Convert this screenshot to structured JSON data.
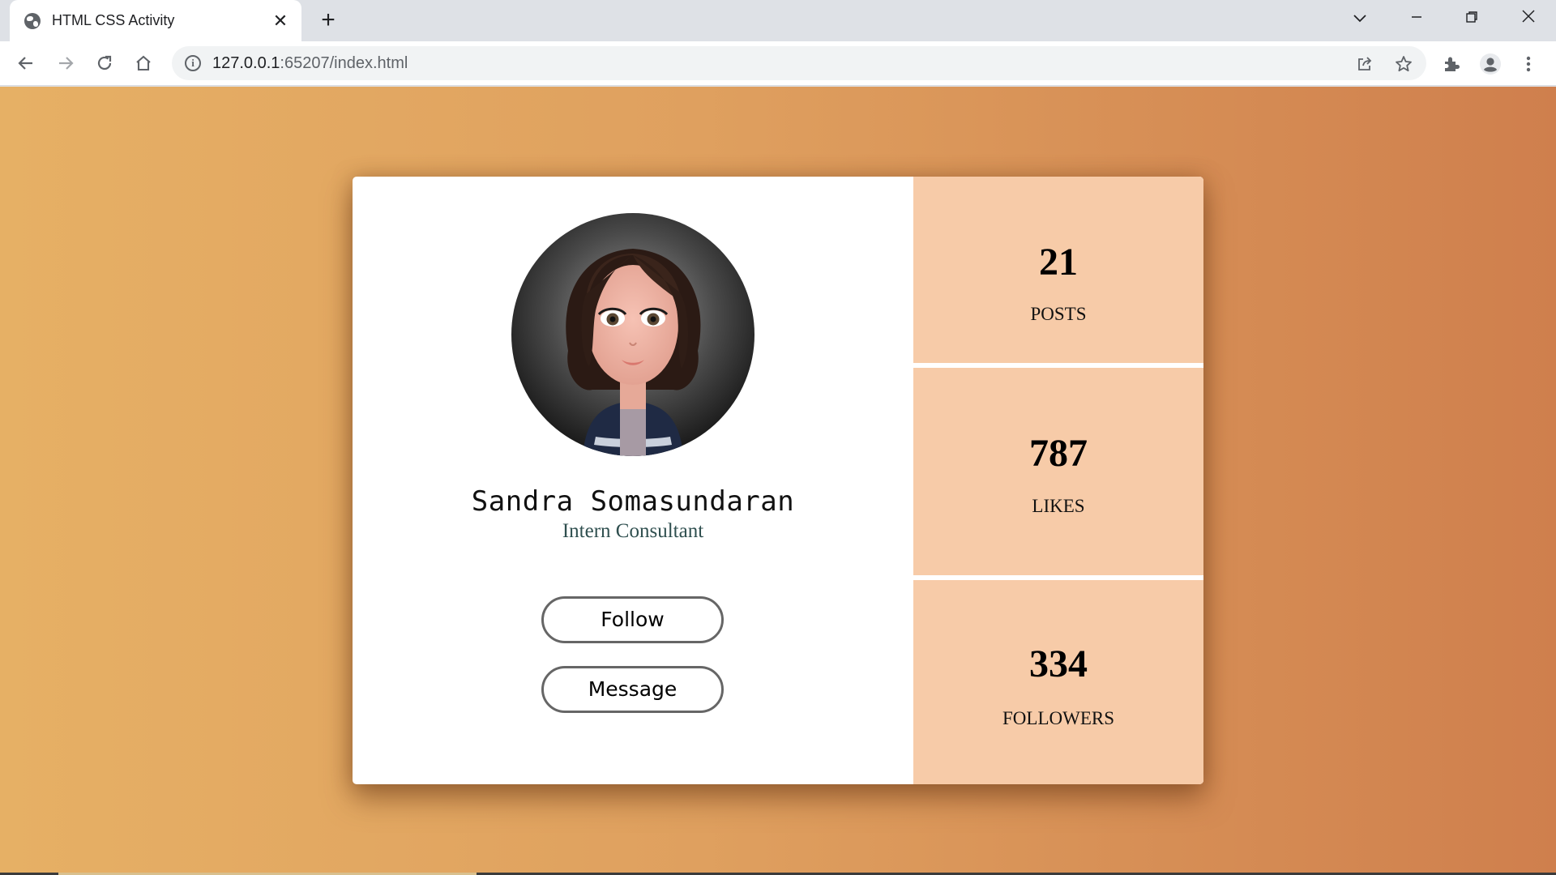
{
  "browser": {
    "tab_title": "HTML CSS Activity",
    "tab_close": "✕",
    "new_tab": "+",
    "url_host": "127.0.0.1",
    "url_rest": ":65207/index.html",
    "icons": [
      "globe-icon",
      "close-icon",
      "plus-icon",
      "chevron-down-icon",
      "minimize-icon",
      "restore-icon",
      "window-close-icon",
      "back-icon",
      "forward-icon",
      "reload-icon",
      "home-icon",
      "info-icon",
      "share-icon",
      "star-icon",
      "extensions-icon",
      "profile-icon",
      "menu-icon"
    ]
  },
  "profile": {
    "name": "Sandra Somasundaran",
    "role": "Intern Consultant",
    "follow_label": "Follow",
    "message_label": "Message"
  },
  "stats": [
    {
      "value": "21",
      "label": "POSTS"
    },
    {
      "value": "787",
      "label": "LIKES"
    },
    {
      "value": "334",
      "label": "FOLLOWERS"
    }
  ],
  "colors": {
    "background_start": "#e6b065",
    "background_end": "#cf7f4d",
    "stat_panel": "#f7cba8",
    "role_text": "#2f4f4f"
  }
}
